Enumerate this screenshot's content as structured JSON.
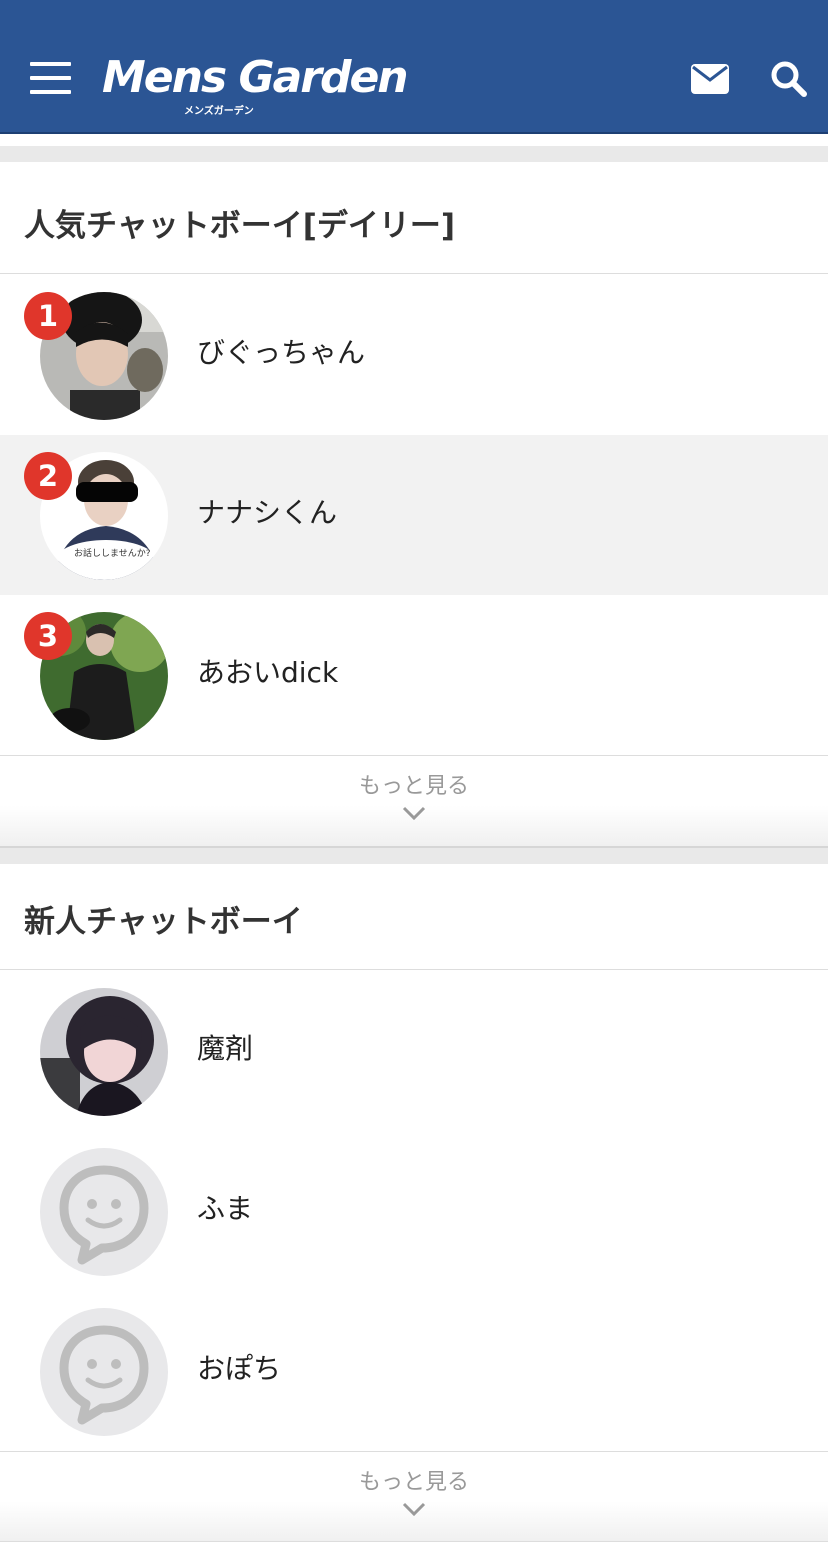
{
  "header": {
    "logo_text": "Mens Garden",
    "logo_subtext": "メンズガーデン",
    "menu_icon": "hamburger-icon",
    "mail_icon": "mail-icon",
    "search_icon": "search-icon",
    "bg_color": "#2b5594"
  },
  "popular": {
    "title": "人気チャットボーイ[デイリー]",
    "items": [
      {
        "rank": "1",
        "name": "びぐっちゃん"
      },
      {
        "rank": "2",
        "name": "ナナシくん",
        "avatar_caption": "お話ししませんか?"
      },
      {
        "rank": "3",
        "name": "あおいdick"
      }
    ],
    "more_label": "もっと見る",
    "rank_color": "#e0362b"
  },
  "newcomers": {
    "title": "新人チャットボーイ",
    "items": [
      {
        "name": "魔剤"
      },
      {
        "name": "ふま"
      },
      {
        "name": "おぽち"
      }
    ],
    "more_label": "もっと見る"
  }
}
